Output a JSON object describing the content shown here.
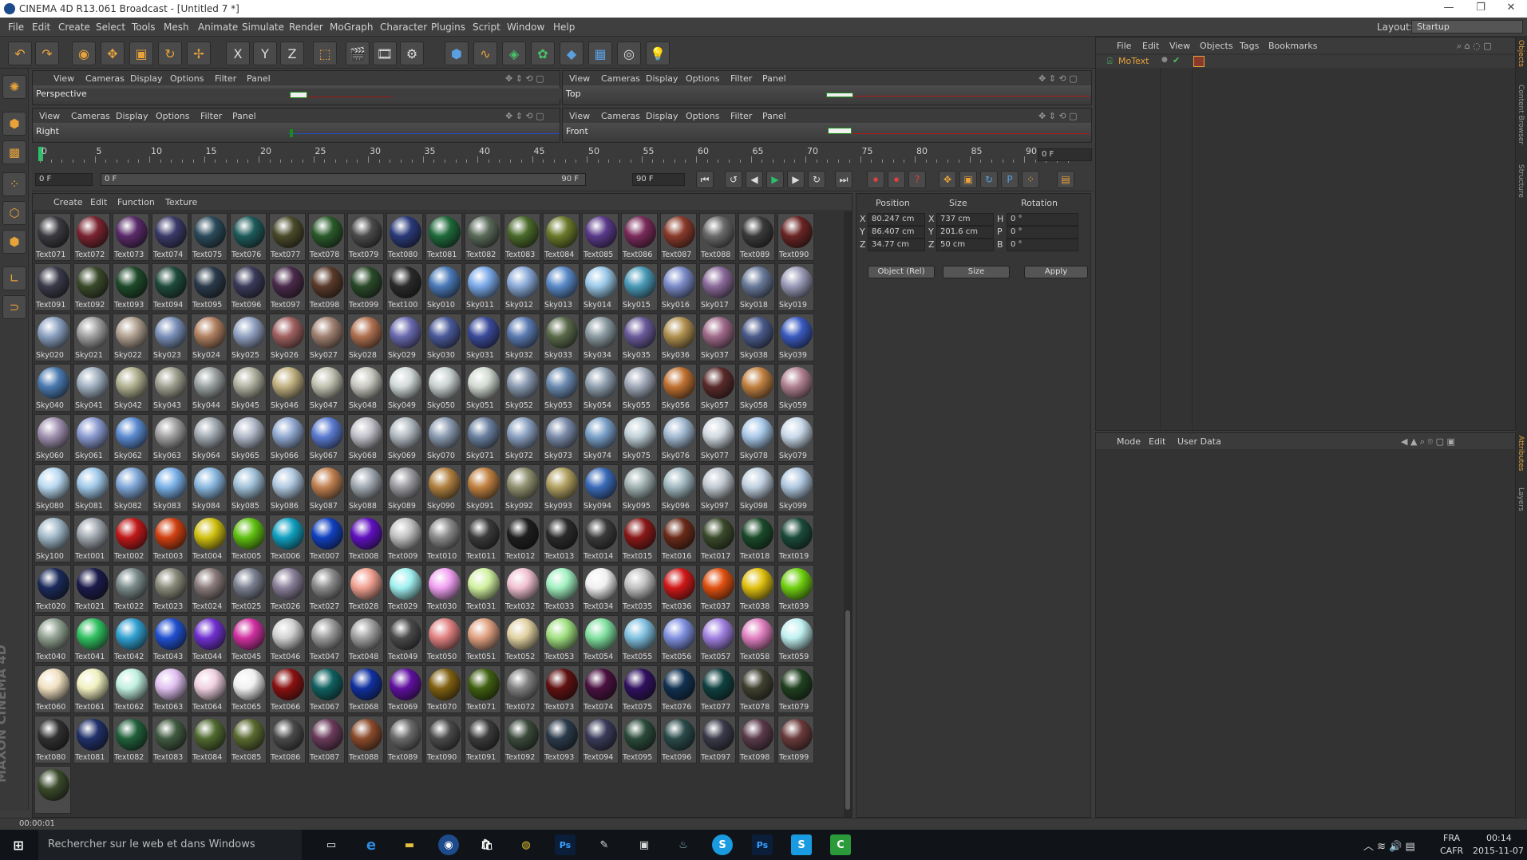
{
  "window": {
    "title": "CINEMA 4D R13.061 Broadcast - [Untitled 7 *]",
    "min": "—",
    "max": "❐",
    "close": "✕"
  },
  "menu": [
    "File",
    "Edit",
    "Create",
    "Select",
    "Tools",
    "Mesh",
    "Animate",
    "Simulate",
    "Render",
    "MoGraph",
    "Character",
    "Plugins",
    "Script",
    "Window",
    "Help"
  ],
  "layout": {
    "label": "Layout:",
    "value": "Startup"
  },
  "axis": {
    "x": "X",
    "y": "Y",
    "z": "Z"
  },
  "viewports": {
    "menu": [
      "View",
      "Cameras",
      "Display",
      "Options",
      "Filter",
      "Panel"
    ],
    "names": [
      "Perspective",
      "Top",
      "Right",
      "Front"
    ]
  },
  "timeline": {
    "ticks": [
      "0",
      "5",
      "10",
      "15",
      "20",
      "25",
      "30",
      "35",
      "40",
      "45",
      "50",
      "55",
      "60",
      "65",
      "70",
      "75",
      "80",
      "85",
      "90"
    ],
    "current": "0 F"
  },
  "transport": {
    "start": "0 F",
    "range_start": "0 F",
    "range_end": "90 F",
    "end": "90 F"
  },
  "materials": {
    "menu": [
      "Create",
      "Edit",
      "Function",
      "Texture"
    ],
    "items": [
      "Text071",
      "Text072",
      "Text073",
      "Text074",
      "Text075",
      "Text076",
      "Text077",
      "Text078",
      "Text079",
      "Text080",
      "Text081",
      "Text082",
      "Text083",
      "Text084",
      "Text085",
      "Text086",
      "Text087",
      "Text088",
      "Text089",
      "Text090",
      "Text091",
      "Text092",
      "Text093",
      "Text094",
      "Text095",
      "Text096",
      "Text097",
      "Text098",
      "Text099",
      "Text100",
      "Sky010",
      "Sky011",
      "Sky012",
      "Sky013",
      "Sky014",
      "Sky015",
      "Sky016",
      "Sky017",
      "Sky018",
      "Sky019",
      "Sky020",
      "Sky021",
      "Sky022",
      "Sky023",
      "Sky024",
      "Sky025",
      "Sky026",
      "Sky027",
      "Sky028",
      "Sky029",
      "Sky030",
      "Sky031",
      "Sky032",
      "Sky033",
      "Sky034",
      "Sky035",
      "Sky036",
      "Sky037",
      "Sky038",
      "Sky039",
      "Sky040",
      "Sky041",
      "Sky042",
      "Sky043",
      "Sky044",
      "Sky045",
      "Sky046",
      "Sky047",
      "Sky048",
      "Sky049",
      "Sky050",
      "Sky051",
      "Sky052",
      "Sky053",
      "Sky054",
      "Sky055",
      "Sky056",
      "Sky057",
      "Sky058",
      "Sky059",
      "Sky060",
      "Sky061",
      "Sky062",
      "Sky063",
      "Sky064",
      "Sky065",
      "Sky066",
      "Sky067",
      "Sky068",
      "Sky069",
      "Sky070",
      "Sky071",
      "Sky072",
      "Sky073",
      "Sky074",
      "Sky075",
      "Sky076",
      "Sky077",
      "Sky078",
      "Sky079",
      "Sky080",
      "Sky081",
      "Sky082",
      "Sky083",
      "Sky084",
      "Sky085",
      "Sky086",
      "Sky087",
      "Sky088",
      "Sky089",
      "Sky090",
      "Sky091",
      "Sky092",
      "Sky093",
      "Sky094",
      "Sky095",
      "Sky096",
      "Sky097",
      "Sky098",
      "Sky099",
      "Sky100",
      "Text001",
      "Text002",
      "Text003",
      "Text004",
      "Text005",
      "Text006",
      "Text007",
      "Text008",
      "Text009",
      "Text010",
      "Text011",
      "Text012",
      "Text013",
      "Text014",
      "Text015",
      "Text016",
      "Text017",
      "Text018",
      "Text019",
      "Text020",
      "Text021",
      "Text022",
      "Text023",
      "Text024",
      "Text025",
      "Text026",
      "Text027",
      "Text028",
      "Text029",
      "Text030",
      "Text031",
      "Text032",
      "Text033",
      "Text034",
      "Text035",
      "Text036",
      "Text037",
      "Text038",
      "Text039",
      "Text040",
      "Text041",
      "Text042",
      "Text043",
      "Text044",
      "Text045",
      "Text046",
      "Text047",
      "Text048",
      "Text049",
      "Text050",
      "Text051",
      "Text052",
      "Text053",
      "Text054",
      "Text055",
      "Text056",
      "Text057",
      "Text058",
      "Text059",
      "Text060",
      "Text061",
      "Text062",
      "Text063",
      "Text064",
      "Text065",
      "Text066",
      "Text067",
      "Text068",
      "Text069",
      "Text070",
      "Text071",
      "Text072",
      "Text073",
      "Text074",
      "Text075",
      "Text076",
      "Text077",
      "Text078",
      "Text079",
      "Text080",
      "Text081",
      "Text082",
      "Text083",
      "Text084",
      "Text085",
      "Text086",
      "Text087",
      "Text088",
      "Text089",
      "Text090",
      "Text091",
      "Text092",
      "Text093",
      "Text094",
      "Text095",
      "Text096",
      "Text097",
      "Text098",
      "Text099",
      ""
    ],
    "colors": [
      "#3a3a40",
      "#7a2430",
      "#5a2a6a",
      "#3a3a6a",
      "#2a4a5a",
      "#1e5a5a",
      "#4a4a2a",
      "#2a5a2a",
      "#4a4a4a",
      "#2a3a7a",
      "#1e6a3a",
      "#5a6a5a",
      "#4a6a2a",
      "#6a7a2a",
      "#5a3a8a",
      "#7a2a5a",
      "#8a3a2a",
      "#6a6a6a",
      "#3a3a3a",
      "#6a2424",
      "#3a3a4a",
      "#3a4a2a",
      "#1e4a2a",
      "#1e4a3a",
      "#2a3a4a",
      "#3a3a5a",
      "#4a2a4a",
      "#5a3a2a",
      "#2a4a2a",
      "#2a2a2a",
      "#4a7ab8",
      "#7aa8e8",
      "#8aaad8",
      "#5a8ac8",
      "#9ac8e8",
      "#4a9ab8",
      "#7a8ac8",
      "#8a6a9a",
      "#6a7a9a",
      "#9a9ab8",
      "#8aa0c0",
      "#a0a0a0",
      "#b0a090",
      "#7a90b8",
      "#b08060",
      "#90a0c0",
      "#a06060",
      "#a08070",
      "#b07050",
      "#6a6ab0",
      "#4a5a9a",
      "#3a4a9a",
      "#5a7ab0",
      "#5a6a4a",
      "#8a9aa0",
      "#6a5a9a",
      "#b09050",
      "#a06a8a",
      "#4a5a8a",
      "#3a5ac0",
      "#4a7ab0",
      "#a0b0c0",
      "#b0b090",
      "#a0a090",
      "#9aa0a0",
      "#b0b0a0",
      "#c0b080",
      "#c0c0b0",
      "#c8c8c0",
      "#d0d8d8",
      "#c8d0d0",
      "#d0d8d0",
      "#8a9ab0",
      "#6a8ab0",
      "#90a0b0",
      "#a0a8b8",
      "#c07030",
      "#5a2a2a",
      "#c08040",
      "#b08090",
      "#a090b0",
      "#8a9ad0",
      "#5a8ad0",
      "#a0a0a0",
      "#a0a8b0",
      "#b0b8c8",
      "#90a8d0",
      "#5a7ad0",
      "#c0c0c8",
      "#b0b8c0",
      "#8a9ab0",
      "#6a80a0",
      "#8aa0c0",
      "#7a8aa8",
      "#7aa0c8",
      "#c0d0d8",
      "#a0b8d0",
      "#d0d8e0",
      "#a8c8e8",
      "#c8d8e8",
      "#b8d8f0",
      "#a0c8e8",
      "#80a8d8",
      "#7ab0e8",
      "#8ab8e0",
      "#a0c0d8",
      "#b0c8e0",
      "#c08050",
      "#a0a8b0",
      "#9a9aa0",
      "#b08040",
      "#c08040",
      "#909070",
      "#b0a060",
      "#3a6ab8",
      "#a0b0b0",
      "#a0b8c0",
      "#c0c8d0",
      "#c0d0e0",
      "#b0c8e0",
      "#a0b8c8",
      "#a0a8b0",
      "#c01818",
      "#d04010",
      "#d0c010",
      "#60c010",
      "#10a0c0",
      "#1040c0",
      "#6010c0",
      "#c0c0c0",
      "#8a8a8a",
      "#3a3a3a",
      "#1e1e1e",
      "#2a2a2a",
      "#3a3a3a",
      "#8a1818",
      "#6a2a18",
      "#3a4a2a",
      "#1a4a2a",
      "#1a4a3a",
      "#1a2a5a",
      "#1a1a4a",
      "#7a8a8a",
      "#8a8a7a",
      "#8a7a7a",
      "#7a8090",
      "#8a809a",
      "#8a8a8a",
      "#f0a090",
      "#a0f0f0",
      "#f0a0f0",
      "#d0f0a0",
      "#f0c0d0",
      "#a0f0c0",
      "#f0f0f0",
      "#c0c0c0",
      "#d01818",
      "#e05010",
      "#e0c010",
      "#70d010",
      "#90a090",
      "#30c060",
      "#30a0d0",
      "#2050d0",
      "#7030d0",
      "#d030a0",
      "#d0d0d0",
      "#9a9a9a",
      "#a0a0a0",
      "#4a4a4a",
      "#e08080",
      "#e0a080",
      "#e0d0a0",
      "#a0e080",
      "#80e0a0",
      "#80c0e0",
      "#8090e0",
      "#a080e0",
      "#e080c0",
      "#c0f0f0",
      "#f0e0c0",
      "#f0f0c0",
      "#c0f0e0",
      "#e0c0f0",
      "#f0d0e0",
      "#f0f0f0",
      "#8a1010",
      "#106060",
      "#1030a0",
      "#6010a0",
      "#806010",
      "#406010",
      "#808080",
      "#601010",
      "#4a1040",
      "#301060",
      "#103050",
      "#104040",
      "#404030",
      "#204020",
      "#303030",
      "#20306a",
      "#20603a",
      "#405a40",
      "#506a30",
      "#5a6a30",
      "#4a4a4a",
      "#6a3a5a",
      "#8a4a2a",
      "#6a6a6a",
      "#4a4a4a",
      "#3a3a3a",
      "#3a4a3a",
      "#2a3a4a",
      "#3a3a5a",
      "#2a4a3a",
      "#2a4a4a",
      "#3a3a4a",
      "#5a3a4a",
      "#6a3a3a",
      "#3a4a2a",
      "#3a3a3a"
    ]
  },
  "coords": {
    "headers": [
      "Position",
      "Size",
      "Rotation"
    ],
    "rows": [
      {
        "a": "X",
        "p": "80.247 cm",
        "b": "X",
        "s": "737 cm",
        "c": "H",
        "r": "0 °"
      },
      {
        "a": "Y",
        "p": "86.407 cm",
        "b": "Y",
        "s": "201.6 cm",
        "c": "P",
        "r": "0 °"
      },
      {
        "a": "Z",
        "p": "34.77 cm",
        "b": "Z",
        "s": "50 cm",
        "c": "B",
        "r": "0 °"
      }
    ],
    "mode": "Object (Rel)",
    "size_mode": "Size",
    "apply": "Apply"
  },
  "objects": {
    "menu": [
      "File",
      "Edit",
      "View",
      "Objects",
      "Tags",
      "Bookmarks"
    ],
    "item": "MoText"
  },
  "attributes": {
    "menu": [
      "Mode",
      "Edit",
      "User Data"
    ]
  },
  "sidetabs": [
    "Objects",
    "Content Browser",
    "Structure",
    "Attributes",
    "Layers"
  ],
  "logo": "MAXON CINEMA 4D",
  "status": {
    "time": "00:00:01"
  },
  "taskbar": {
    "search": "Rechercher sur le web et dans Windows",
    "lang1": "FRA",
    "lang2": "CAFR",
    "time": "00:14",
    "date": "2015-11-07"
  },
  "accent": "#e8a23a"
}
